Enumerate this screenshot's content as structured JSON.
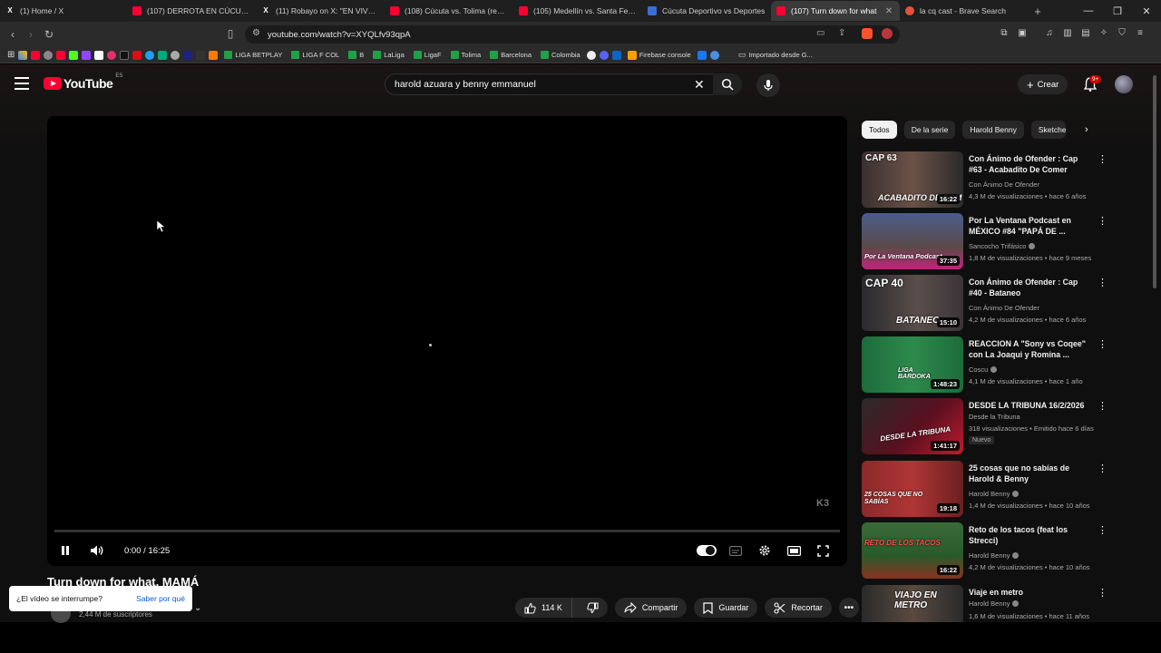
{
  "browser": {
    "tabs": [
      {
        "label": "(1) Home / X",
        "icon": "x-logo"
      },
      {
        "label": "(107) DERROTA EN CÚCUTA - I",
        "icon": "youtube-logo"
      },
      {
        "label": "(11) Robayo on X: \"EN VIVO. (",
        "icon": "x-logo"
      },
      {
        "label": "(108) Cúcuta vs. Tolima (resum",
        "icon": "youtube-logo"
      },
      {
        "label": "(105) Medellín vs. Santa Fe (res",
        "icon": "youtube-logo"
      },
      {
        "label": "Cúcuta Deportivo vs Deportes",
        "icon": "site-logo"
      },
      {
        "label": "(107) Turn down for what",
        "icon": "youtube-logo",
        "active": true
      },
      {
        "label": "la cq cast - Brave Search",
        "icon": "brave-logo"
      }
    ],
    "url": "youtube.com/watch?v=XYQLfv93qpA",
    "bookmarks": [
      "LIGA BETPLAY",
      "LIGA F COL",
      "B",
      "LaLiga",
      "LigaF",
      "Tolima",
      "Barcelona",
      "Colombia",
      "Firebase console",
      "Importado desde G..."
    ]
  },
  "youtube": {
    "logo_text": "YouTube",
    "logo_region": "ES",
    "search_query": "harold azuara y benny emmanuel",
    "create_label": "Crear",
    "notification_count": "9+",
    "player": {
      "time": "0:00 / 16:25",
      "watermark": "K3"
    },
    "video_title": "Turn down for what, MAMÁ",
    "subscribers": "2,44 M de suscriptores",
    "tooltip": {
      "text": "¿El vídeo se interrumpe?",
      "link": "Saber por qué"
    },
    "actions": {
      "likes": "114 K",
      "share": "Compartir",
      "save": "Guardar",
      "clip": "Recortar"
    },
    "chips": [
      "Todos",
      "De la serie",
      "Harold Benny",
      "Sketche"
    ],
    "recommendations": [
      {
        "title": "Con Ánimo de Ofender : Cap #63 - Acabadito De Comer",
        "channel": "Con Ánimo De Ofender",
        "meta": "4,3 M de visualizaciones • hace 6 años",
        "duration": "16:22",
        "overlay_top": "CAP 63",
        "overlay_bottom": "ACABADITO DE COM"
      },
      {
        "title": "Por La Ventana Podcast en MÉXICO #84 \"PAPÁ DE ...",
        "channel": "Sancocho Trifásico",
        "meta": "1,8 M de visualizaciones • hace 9 meses",
        "duration": "37:35",
        "overlay_top": "",
        "overlay_bottom": "Por La Ventana Podcast"
      },
      {
        "title": "Con Ánimo de Ofender : Cap #40 - Bataneo",
        "channel": "Con Ánimo De Ofender",
        "meta": "4,2 M de visualizaciones • hace 6 años",
        "duration": "15:10",
        "overlay_top": "CAP 40",
        "overlay_bottom": "BATANEO"
      },
      {
        "title": "REACCION A \"Sony vs Coqee\" con La Joaqui y Romina ...",
        "channel": "Coscu",
        "meta": "4,1 M de visualizaciones • hace 1 año",
        "duration": "1:48:23",
        "overlay_top": "",
        "overlay_bottom": "LIGA BARDOKA"
      },
      {
        "title": "DESDE LA TRIBUNA 16/2/2026",
        "channel": "Desde la Tribuna",
        "meta": "318 visualizaciones • Emitido hace 6 días",
        "duration": "1:41:17",
        "overlay_top": "",
        "overlay_bottom": "DESDE LA TRIBUNA",
        "badge": "Nuevo"
      },
      {
        "title": "25 cosas que no sabías de Harold & Benny",
        "channel": "Harold Benny",
        "meta": "1,4 M de visualizaciones • hace 10 años",
        "duration": "19:18",
        "overlay_top": "",
        "overlay_bottom": "25 COSAS QUE NO SABÍAS"
      },
      {
        "title": "Reto de los tacos (feat los Strecci)",
        "channel": "Harold Benny",
        "meta": "4,2 M de visualizaciones • hace 10 años",
        "duration": "16:22",
        "overlay_top": "",
        "overlay_bottom": "RETO DE LOS TACOS"
      },
      {
        "title": "Viaje en metro",
        "channel": "Harold Benny",
        "meta": "1,6 M de visualizaciones • hace 11 años",
        "duration": "",
        "overlay_top": "",
        "overlay_bottom": "VIAJO EN METRO"
      }
    ]
  }
}
